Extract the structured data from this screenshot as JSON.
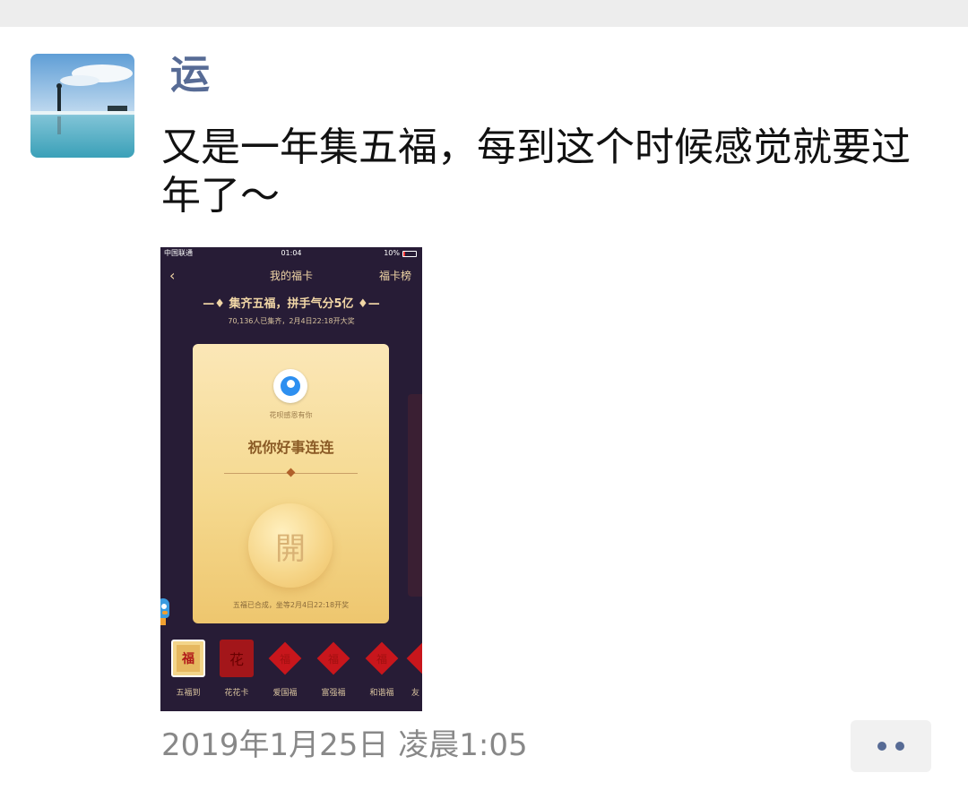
{
  "moment": {
    "author": "运",
    "text": "又是一年集五福，每到这个时候感觉就要过年了～",
    "timestamp": "2019年1月25日 凌晨1:05"
  },
  "embedded_screenshot": {
    "status": {
      "carrier": "中国联通",
      "time": "01:04",
      "battery": "10%"
    },
    "nav": {
      "title": "我的福卡",
      "right_link": "福卡榜",
      "back_symbol": "‹"
    },
    "headline": "—♦ 集齐五福，拼手气分5亿 ♦—",
    "subline": "70,136人已集齐，2月4日22:18开大奖",
    "card": {
      "sponsor": "花呗感恩有你",
      "wish": "祝你好事连连",
      "open_char": "開",
      "footer": "五福已合成，坐等2月4日22:18开奖"
    },
    "fu_cards": [
      {
        "label": "五福到",
        "glyph": "福"
      },
      {
        "label": "花花卡",
        "glyph": "花"
      },
      {
        "label": "爱国福",
        "glyph": "福"
      },
      {
        "label": "富强福",
        "glyph": "福"
      },
      {
        "label": "和谐福",
        "glyph": "福"
      },
      {
        "label": "友",
        "glyph": ""
      }
    ]
  },
  "colors": {
    "author_link": "#576b95",
    "app_background": "#271c36",
    "gold_text": "#f1d6a6"
  }
}
